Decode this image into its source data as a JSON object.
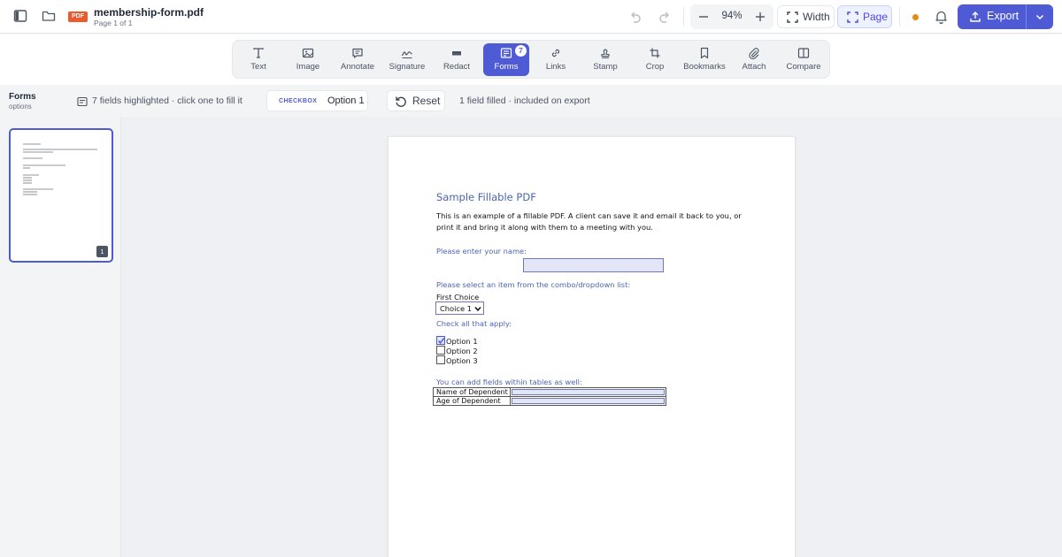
{
  "header": {
    "file_badge": "PDF",
    "file_name": "membership-form.pdf",
    "page_info": "Page 1 of 1",
    "zoom": "94%",
    "fit_width_label": "Width",
    "fit_page_label": "Page",
    "export_label": "Export",
    "accent_color": "#4f5bd5",
    "status_dot_color": "#e58a16"
  },
  "tools": [
    {
      "label": "Text",
      "icon": "text-icon"
    },
    {
      "label": "Image",
      "icon": "image-icon"
    },
    {
      "label": "Annotate",
      "icon": "annotate-icon"
    },
    {
      "label": "Signature",
      "icon": "signature-icon"
    },
    {
      "label": "Redact",
      "icon": "redact-icon"
    },
    {
      "label": "Forms",
      "icon": "forms-icon",
      "badge": "7",
      "active": true
    },
    {
      "label": "Links",
      "icon": "link-icon"
    },
    {
      "label": "Stamp",
      "icon": "stamp-icon"
    },
    {
      "label": "Crop",
      "icon": "crop-icon"
    },
    {
      "label": "Bookmarks",
      "icon": "bookmark-icon"
    },
    {
      "label": "Attach",
      "icon": "paperclip-icon"
    },
    {
      "label": "Compare",
      "icon": "compare-icon"
    }
  ],
  "forms_bar": {
    "title": "Forms",
    "subtitle": "options",
    "highlight_text": "7 fields highlighted · click one to fill it",
    "field_kind": "CHECKBOX",
    "field_value": "Option 1",
    "reset_label": "Reset",
    "filled_text": "1 field filled · included on export"
  },
  "sidebar": {
    "thumbnails": [
      {
        "page_number": "1",
        "selected": true
      }
    ]
  },
  "document": {
    "title": "Sample Fillable PDF",
    "intro": "This is an example of a fillable PDF. A client can save it and email it back to you, or print it and bring it along with them to a meeting with you.",
    "name_prompt": "Please enter your name:",
    "combo_prompt": "Please select an item from the combo/dropdown list:",
    "combo_label": "First Choice",
    "combo_value": "Choice 1",
    "check_prompt": "Check all that apply:",
    "options": [
      {
        "label": "Option 1",
        "checked": true
      },
      {
        "label": "Option 2",
        "checked": false
      },
      {
        "label": "Option 3",
        "checked": false
      }
    ],
    "table_prompt": "You can add  fields within tables as well:",
    "table_rows": [
      "Name of Dependent",
      "Age of Dependent"
    ]
  }
}
